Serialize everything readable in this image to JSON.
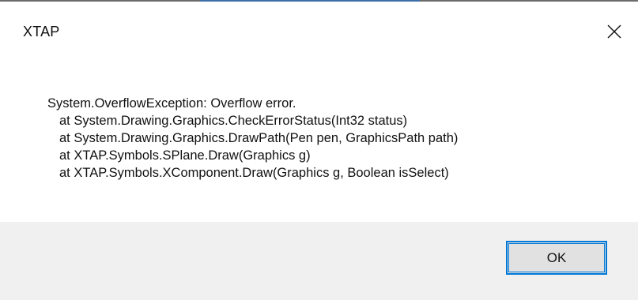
{
  "window": {
    "title": "XTAP",
    "close_icon": "close-icon"
  },
  "message": {
    "lines": [
      "System.OverflowException: Overflow error.",
      "at System.Drawing.Graphics.CheckErrorStatus(Int32 status)",
      "at System.Drawing.Graphics.DrawPath(Pen pen, GraphicsPath path)",
      "at XTAP.Symbols.SPlane.Draw(Graphics g)",
      "at XTAP.Symbols.XComponent.Draw(Graphics g, Boolean isSelect)"
    ]
  },
  "buttons": {
    "ok_label": "OK"
  },
  "colors": {
    "accent": "#0078d7",
    "footer_bg": "#f0f0f0",
    "button_bg": "#e1e1e1"
  }
}
